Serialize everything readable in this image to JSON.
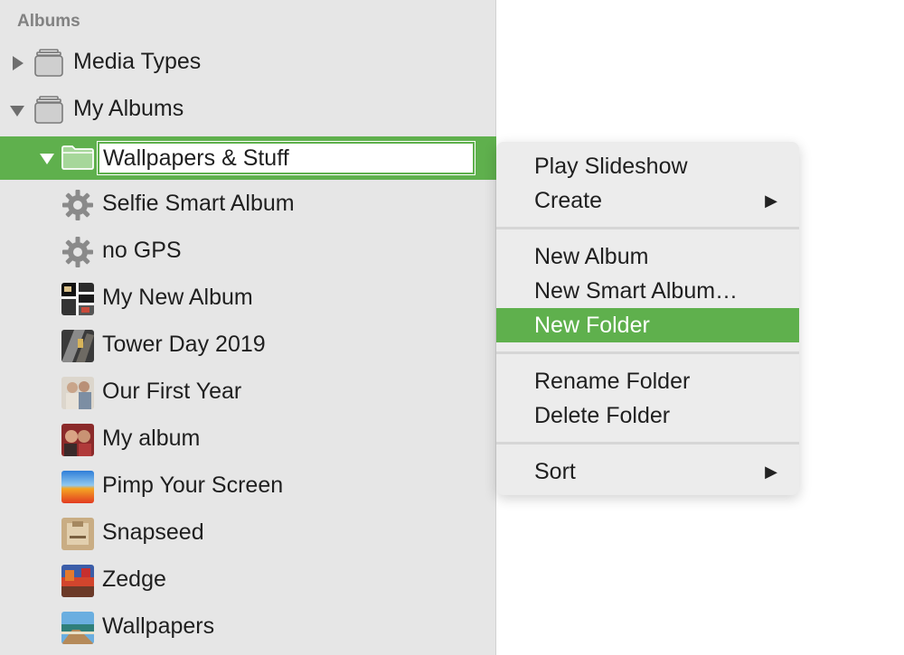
{
  "sidebar": {
    "section_header": "Albums",
    "media_types": {
      "label": "Media Types"
    },
    "my_albums": {
      "label": "My Albums"
    },
    "selected_folder": {
      "value": "Wallpapers & Stuff"
    },
    "items": [
      {
        "label": "Selfie Smart Album",
        "icon": "gear-icon"
      },
      {
        "label": "no GPS",
        "icon": "gear-icon"
      },
      {
        "label": "My New Album",
        "icon": "album-thumbnail"
      },
      {
        "label": "Tower Day 2019",
        "icon": "album-thumbnail"
      },
      {
        "label": "Our First Year",
        "icon": "album-thumbnail"
      },
      {
        "label": "My album",
        "icon": "album-thumbnail"
      },
      {
        "label": "Pimp Your Screen",
        "icon": "album-thumbnail"
      },
      {
        "label": "Snapseed",
        "icon": "album-thumbnail"
      },
      {
        "label": "Zedge",
        "icon": "album-thumbnail"
      },
      {
        "label": "Wallpapers",
        "icon": "album-thumbnail"
      }
    ]
  },
  "context_menu": {
    "play_slideshow": "Play Slideshow",
    "create": "Create",
    "new_album": "New Album",
    "new_smart_album": "New Smart Album…",
    "new_folder": "New Folder",
    "rename_folder": "Rename Folder",
    "delete_folder": "Delete Folder",
    "sort": "Sort",
    "submenu_arrow": "▶"
  },
  "colors": {
    "selection": "#5fb04d",
    "sidebar_bg": "#e6e6e6",
    "menu_bg": "#ececec"
  }
}
